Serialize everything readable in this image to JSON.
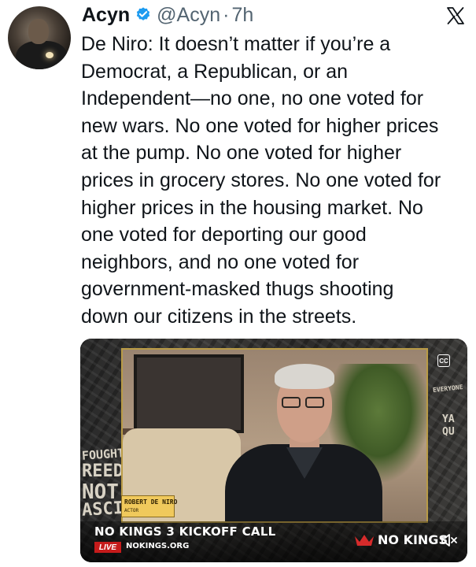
{
  "author": {
    "name": "Acyn",
    "handle": "@Acyn",
    "separator": "·",
    "time": "7h",
    "verified": true
  },
  "tweet": {
    "text": "De Niro: It doesn’t matter if you’re a\nDemocrat, a Republican, or an\nIndependent—no one, no one voted for\nnew wars. No one voted for higher prices\nat the pump. No one voted for higher\nprices in grocery stores. No one voted for\nhigher prices in the housing market. No\none voted for deporting our good\nneighbors, and no one voted for\ngovernment-masked thugs shooting\ndown our citizens in the streets."
  },
  "video": {
    "lower_third_name": "ROBERT DE NIRO",
    "lower_third_role": "ACTOR",
    "event_title": "NO KINGS 3 KICKOFF CALL",
    "live_label": "LIVE",
    "site_url": "NOKINGS.ORG",
    "brand": "NO KINGS",
    "cc_label": "CC",
    "poster_words": [
      "FOUGHT",
      "REEDO",
      "NOT",
      "ASCIS",
      "EVERYONE",
      "YA",
      "QU"
    ]
  },
  "colors": {
    "verified_blue": "#1d9bf0",
    "secondary_text": "#536471",
    "frame_gold": "#b99b46",
    "live_red": "#c51b1b"
  },
  "icons": {
    "verified": "verified-badge-icon",
    "platform": "x-logo-icon",
    "captions": "cc-icon",
    "mute": "speaker-muted-icon",
    "brand": "crown-icon"
  }
}
